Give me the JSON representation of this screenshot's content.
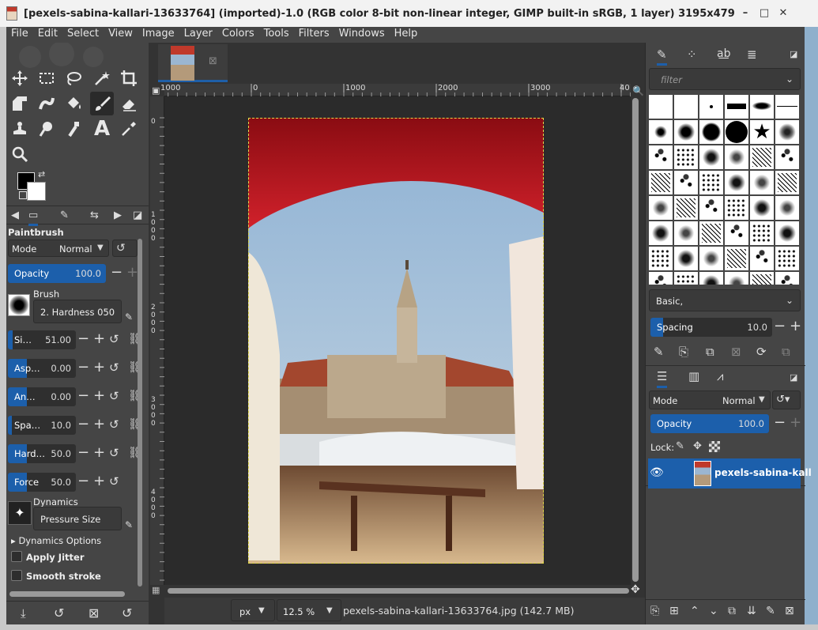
{
  "window": {
    "title": "[pexels-sabina-kallari-13633764] (imported)-1.0 (RGB color 8-bit non-linear integer, GIMP built-in sRGB, 1 layer) 3195x4792 – GIMP",
    "min": "–",
    "max": "□",
    "close": "✕"
  },
  "menu": [
    "File",
    "Edit",
    "Select",
    "View",
    "Image",
    "Layer",
    "Colors",
    "Tools",
    "Filters",
    "Windows",
    "Help"
  ],
  "tool_options": {
    "tool_name": "Paintbrush",
    "mode_label": "Mode",
    "mode_value": "Normal",
    "opacity_label": "Opacity",
    "opacity_value": "100.0",
    "opacity_level": 1.0,
    "brush_label": "Brush",
    "brush_value": "2. Hardness 050",
    "sliders": [
      {
        "label": "Si…",
        "value": "51.00",
        "fill": 0.12
      },
      {
        "label": "Asp…",
        "value": "0.00",
        "fill": 0.5
      },
      {
        "label": "An…",
        "value": "0.00",
        "fill": 0.5
      },
      {
        "label": "Spa…",
        "value": "10.0",
        "fill": 0.1
      },
      {
        "label": "Hard…",
        "value": "50.0",
        "fill": 0.5
      },
      {
        "label": "Force",
        "value": "50.0",
        "fill": 0.5
      }
    ],
    "dynamics_label": "Dynamics",
    "dynamics_value": "Pressure Size",
    "dynamics_options": "Dynamics Options",
    "apply_jitter": "Apply Jitter",
    "smooth_stroke": "Smooth stroke"
  },
  "canvas": {
    "ruler_h": [
      "1000",
      "0",
      "1000",
      "2000",
      "3000",
      "40"
    ],
    "ruler_v": [
      "0",
      "1000",
      "2000",
      "3000",
      "4000"
    ],
    "unit": "px",
    "zoom": "12.5 %",
    "status": "pexels-sabina-kallari-13633764.jpg (142.7 MB)"
  },
  "brushes": {
    "filter_placeholder": "filter",
    "preset": "Basic,",
    "spacing_label": "Spacing",
    "spacing_value": "10.0"
  },
  "layers": {
    "mode_label": "Mode",
    "mode_value": "Normal",
    "opacity_label": "Opacity",
    "opacity_value": "100.0",
    "lock_label": "Lock:",
    "layer_name": "pexels-sabina-kall"
  },
  "colors": {
    "accent": "#1c5fab",
    "panel": "#454545",
    "canvas": "#333333"
  }
}
